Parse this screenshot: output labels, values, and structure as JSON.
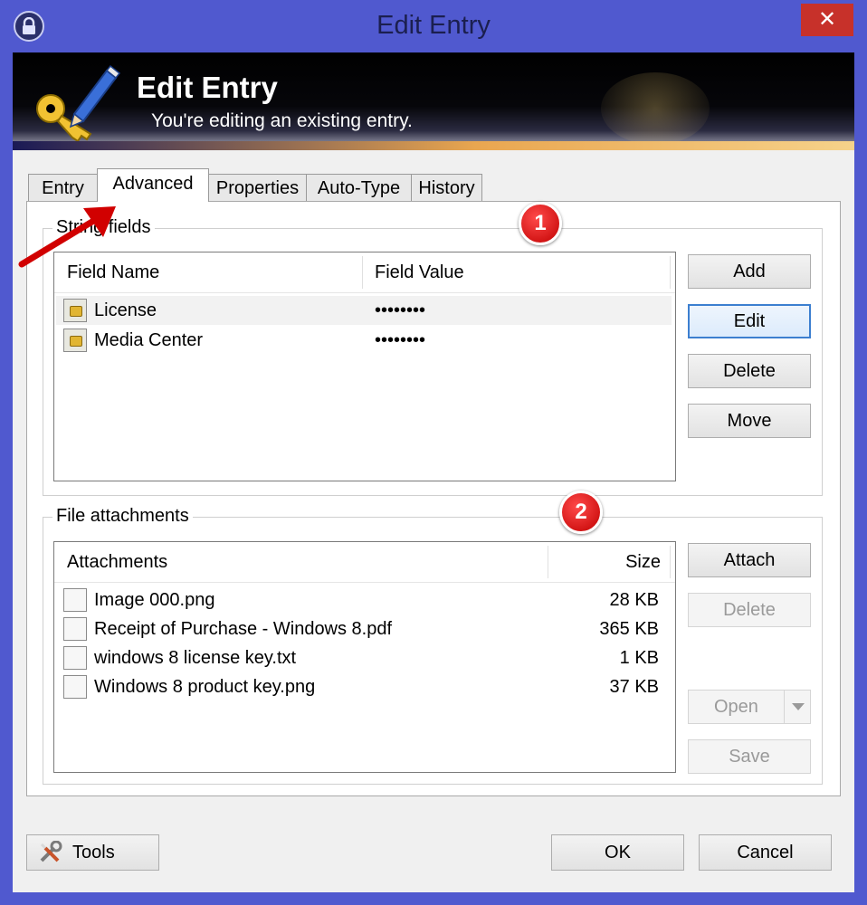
{
  "window": {
    "title": "Edit Entry",
    "close_glyph": "✕",
    "app_icon": "lock-icon"
  },
  "banner": {
    "title": "Edit Entry",
    "subtitle": "You're editing an existing entry."
  },
  "tabs": [
    {
      "label": "Entry"
    },
    {
      "label": "Advanced"
    },
    {
      "label": "Properties"
    },
    {
      "label": "Auto-Type"
    },
    {
      "label": "History"
    }
  ],
  "string_fields": {
    "legend": "String fields",
    "columns": {
      "name": "Field Name",
      "value": "Field Value"
    },
    "rows": [
      {
        "name": "License",
        "value": "••••••••"
      },
      {
        "name": "Media Center",
        "value": "••••••••"
      }
    ],
    "buttons": {
      "add": "Add",
      "edit": "Edit",
      "delete": "Delete",
      "move": "Move"
    }
  },
  "attachments": {
    "legend": "File attachments",
    "columns": {
      "name": "Attachments",
      "size": "Size"
    },
    "rows": [
      {
        "name": "Image 000.png",
        "size": "28 KB"
      },
      {
        "name": "Receipt of Purchase - Windows 8.pdf",
        "size": "365 KB"
      },
      {
        "name": "windows 8 license key.txt",
        "size": "1 KB"
      },
      {
        "name": "Windows 8 product key.png",
        "size": "37 KB"
      }
    ],
    "buttons": {
      "attach": "Attach",
      "delete": "Delete",
      "open": "Open",
      "save": "Save"
    }
  },
  "callouts": {
    "one": "1",
    "two": "2"
  },
  "footer": {
    "tools": "Tools",
    "ok": "OK",
    "cancel": "Cancel"
  },
  "colors": {
    "title_bar": "#5059cf",
    "close_button": "#c7312a",
    "focus_border": "#3c7fd0",
    "callout_red": "#d10000"
  }
}
